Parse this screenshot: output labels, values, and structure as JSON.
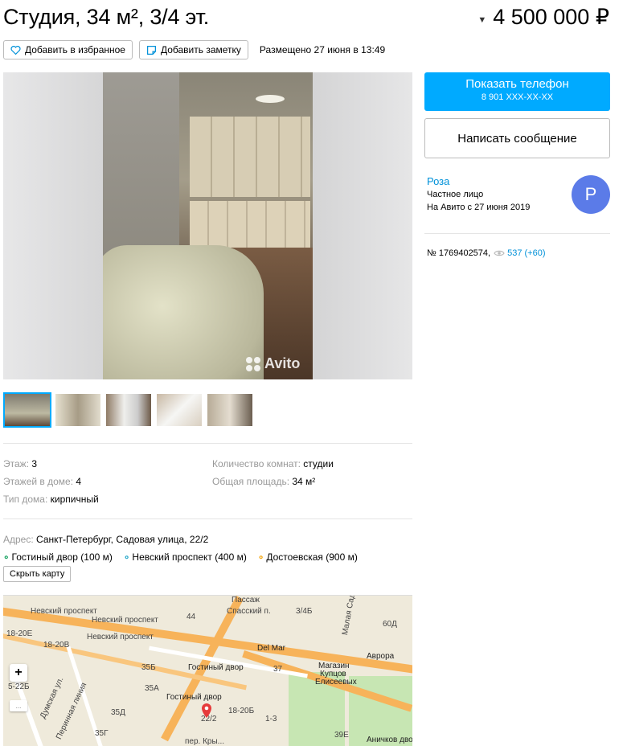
{
  "listing": {
    "title": "Студия, 34 м², 3/4 эт.",
    "price": "4 500 000 ₽",
    "placed": "Размещено 27 июня в 13:49"
  },
  "actions": {
    "favorite_label": "Добавить в избранное",
    "note_label": "Добавить заметку"
  },
  "gallery": {
    "watermark": "Avito",
    "thumbnails": [
      "photo-1",
      "photo-2",
      "photo-3",
      "photo-4",
      "photo-5"
    ]
  },
  "params": {
    "floor_label": "Этаж:",
    "floor_value": "3",
    "floors_label": "Этажей в доме:",
    "floors_value": "4",
    "house_label": "Тип дома:",
    "house_value": "кирпичный",
    "rooms_label": "Количество комнат:",
    "rooms_value": "студии",
    "area_label": "Общая площадь:",
    "area_value": "34 м²"
  },
  "address": {
    "label": "Адрес:",
    "value": "Санкт-Петербург, Садовая улица, 22/2",
    "metro": [
      {
        "name": "Гостиный двор (100 м)",
        "color": "#0a9d58"
      },
      {
        "name": "Невский проспект (400 м)",
        "color": "#1aa3c6"
      },
      {
        "name": "Достоевская (900 м)",
        "color": "#f2a000"
      }
    ],
    "hide_map_label": "Скрыть карту"
  },
  "map": {
    "labels": {
      "nevsky1": "Невский проспект",
      "nevsky2": "Невский проспект",
      "nevsky3": "Невский проспект",
      "passage": "Пассаж",
      "spassky": "Спасский п.",
      "house_3_4": "3/4Б",
      "house_44": "44",
      "house_60d": "60Д",
      "house_18_20e": "18-20Е",
      "house_18_20v": "18-20В",
      "delmar": "Del Mar",
      "gostiny1": "Гостиный двор",
      "gostiny2": "Гостиный двор",
      "magazin": "Магазин",
      "kuptsov": "Купцов",
      "eliseev": "Елисеевых",
      "avrora": "Аврора",
      "house_35b": "35Б",
      "house_35a": "35А",
      "house_35d": "35Д",
      "house_35g": "35Г",
      "house_37": "37",
      "house_13": "1-3",
      "house_18_20b": "18-20Б",
      "house_22_2": "22/2",
      "house_39e": "39Е",
      "dumskaya": "Думская ул.",
      "perinnaya": "Перинная линия",
      "malaya_sad": "Малая Садо...",
      "per_krylova": "пер. Кры...",
      "anichkov": "Аничков двор",
      "house_5_22b": "5-22Б",
      "zoom_plus": "+",
      "slider": "..."
    }
  },
  "sidebar": {
    "show_phone_label": "Показать телефон",
    "phone_masked": "8 901 XXX-XX-XX",
    "write_message_label": "Написать сообщение",
    "seller_name": "Роза",
    "seller_type": "Частное лицо",
    "seller_since": "На Авито с 27 июня 2019",
    "avatar_letter": "Р",
    "ad_number": "№ 1769402574,",
    "views": "537 (+60)"
  },
  "colors": {
    "accent": "#00aaff",
    "link": "#0091d9",
    "avatar": "#5b7be8"
  }
}
